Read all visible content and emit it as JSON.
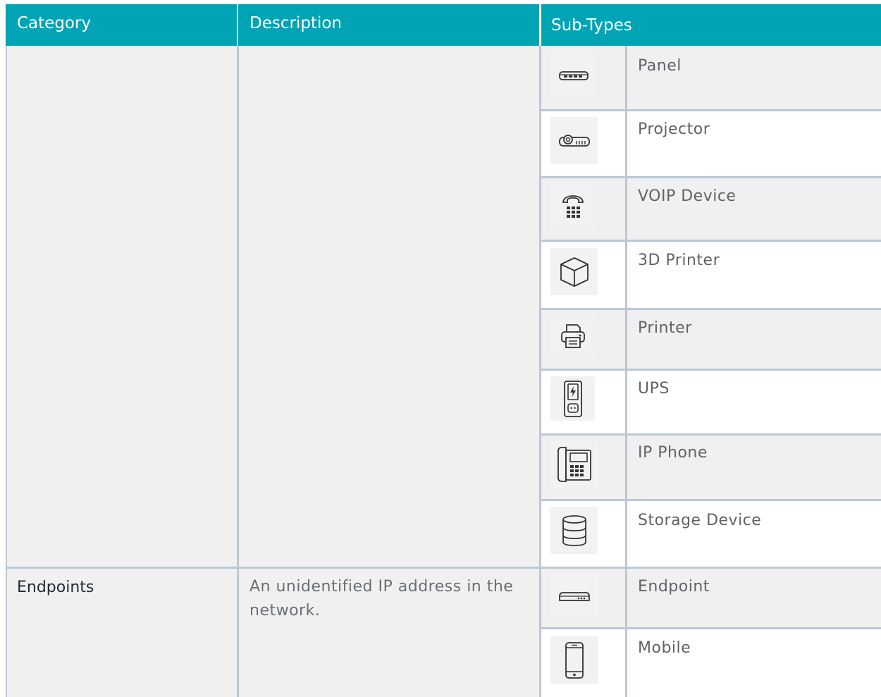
{
  "table": {
    "headers": {
      "category": "Category",
      "description": "Description",
      "subtypes": "Sub-Types"
    },
    "rows": [
      {
        "category": "",
        "description": "",
        "subtypes": [
          {
            "label": "Panel",
            "icon": "panel-switch-icon"
          },
          {
            "label": "Projector",
            "icon": "projector-icon"
          },
          {
            "label": "VOIP Device",
            "icon": "voip-phone-icon"
          },
          {
            "label": "3D Printer",
            "icon": "3d-cube-icon"
          },
          {
            "label": "Printer",
            "icon": "printer-icon"
          },
          {
            "label": "UPS",
            "icon": "ups-battery-icon"
          },
          {
            "label": "IP Phone",
            "icon": "ip-phone-icon"
          },
          {
            "label": "Storage Device",
            "icon": "database-storage-icon"
          }
        ]
      },
      {
        "category": "Endpoints",
        "description": "An unidentified IP address in the network.",
        "subtypes": [
          {
            "label": "Endpoint",
            "icon": "endpoint-device-icon"
          },
          {
            "label": "Mobile",
            "icon": "mobile-phone-icon"
          }
        ]
      }
    ]
  },
  "colors": {
    "header_bg": "#01a4b5",
    "header_text": "#ffffff",
    "border": "#b9c8d6",
    "cell_grey": "#f0f0f0"
  }
}
